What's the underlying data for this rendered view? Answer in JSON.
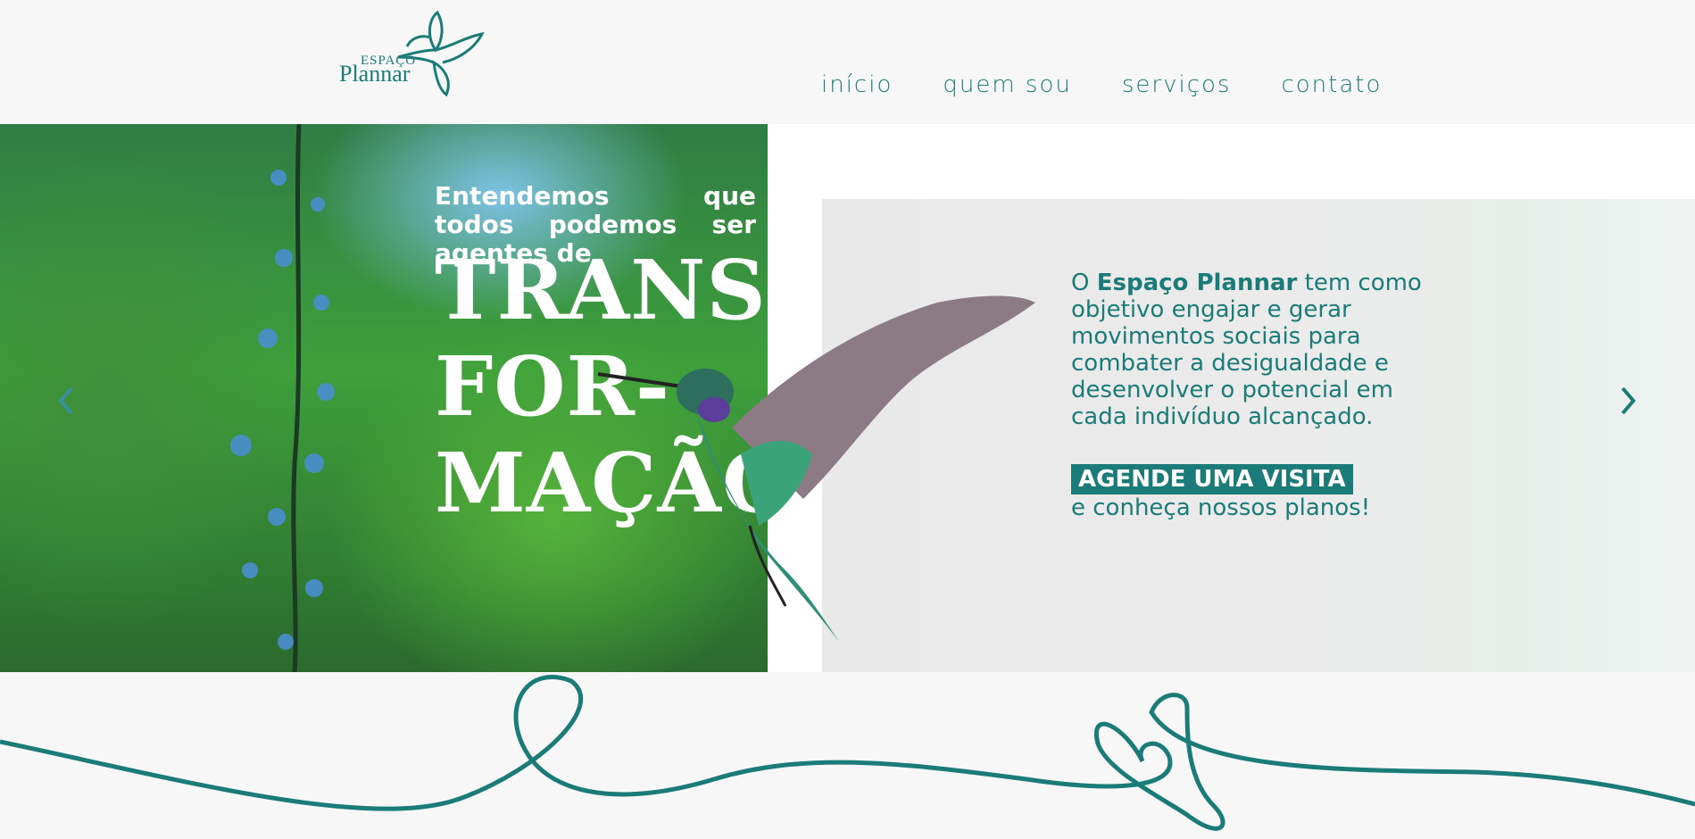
{
  "brand": {
    "small": "ESPAÇO",
    "name": "Plannar"
  },
  "nav": {
    "items": [
      "início",
      "quem sou",
      "serviços",
      "contato"
    ]
  },
  "hero": {
    "slogan_line1": "Entendemos que todos podemos ser agentes de",
    "big_word_1": "TRANS",
    "big_word_2": "FOR-",
    "big_word_3": "MAÇÃO",
    "desc_prefix": "O ",
    "desc_bold": "Espaço Plannar",
    "desc_rest": " tem como objetivo engajar e gerar movimentos sociais para combater a desigualdade e desenvolver o potencial em cada indivíduo alcançado.",
    "cta_label": "AGENDE UMA VISITA",
    "cta_sub": "e conheça nossos planos!"
  },
  "colors": {
    "accent": "#1a7b78",
    "background": "#f7f7f7"
  },
  "icons": [
    "chevron-left-icon",
    "chevron-right-icon",
    "hummingbird-logo-icon"
  ]
}
